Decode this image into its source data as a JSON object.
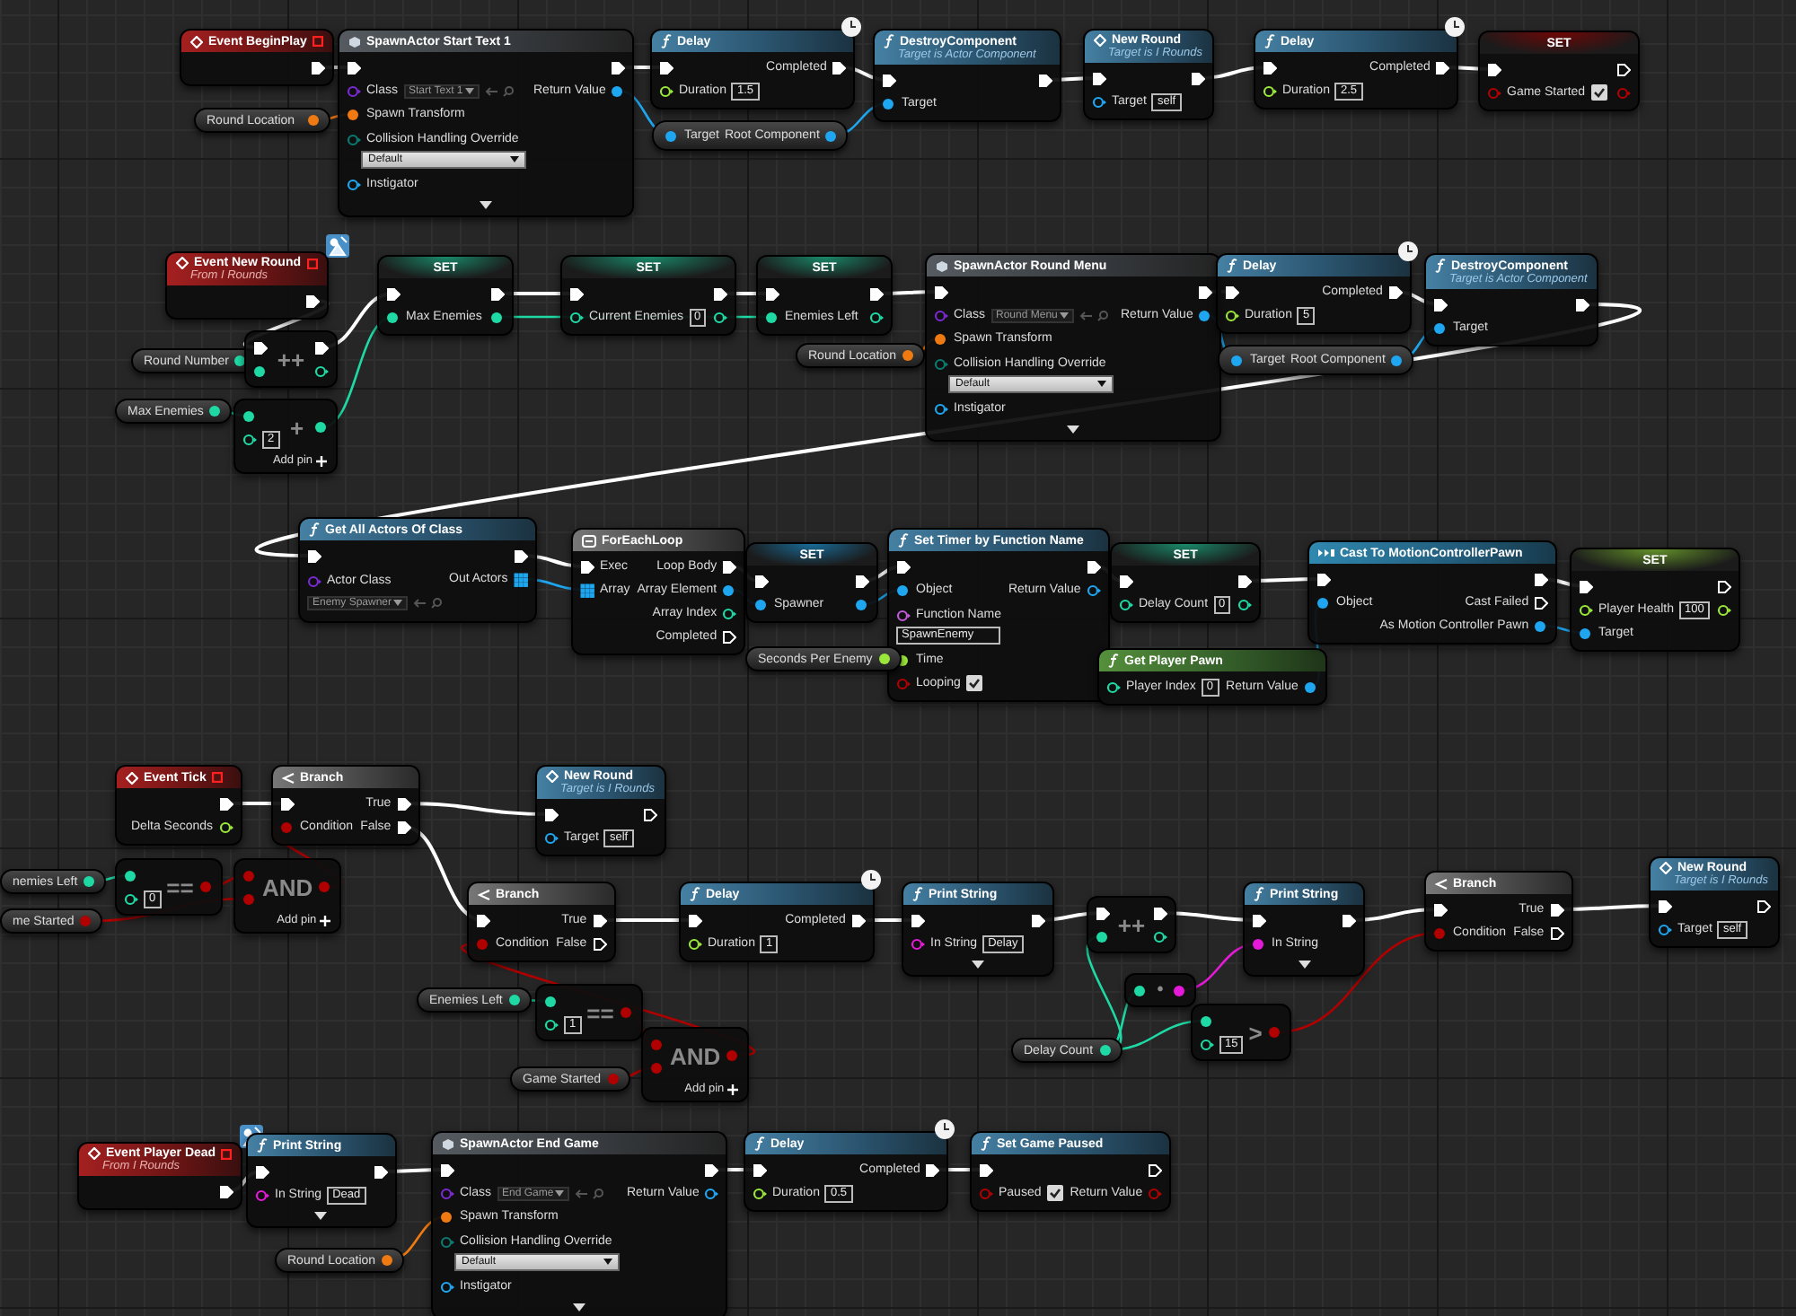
{
  "graph": {
    "nodes": [
      {
        "kind": "event",
        "title": "Event BeginPlay",
        "outputs": [
          {
            "kind": "exec",
            "linked": true
          }
        ]
      },
      {
        "kind": "variable",
        "title": "Round Location",
        "outputs": [
          {
            "kind": "struct",
            "linked": true
          }
        ]
      },
      {
        "kind": "spawn",
        "title": "SpawnActor Start Text 1",
        "advanced": true,
        "inputs": [
          {
            "kind": "exec",
            "linked": true
          },
          {
            "kind": "class",
            "label": "Class",
            "select": "Start Text 1",
            "linked": false
          },
          {
            "kind": "struct",
            "label": "Spawn Transform",
            "linked": true
          },
          {
            "kind": "byte",
            "label": "Collision Handling Override",
            "select": "Default",
            "stacked": true,
            "linked": false
          },
          {
            "kind": "object",
            "label": "Instigator",
            "linked": false
          }
        ],
        "outputs": [
          {
            "kind": "exec",
            "linked": true
          },
          {
            "kind": "object",
            "label": "Return Value",
            "linked": true
          }
        ]
      },
      {
        "kind": "function",
        "title": "Delay",
        "latent": true,
        "inputs": [
          {
            "kind": "exec",
            "linked": true
          },
          {
            "kind": "float",
            "label": "Duration",
            "value": "1.5",
            "linked": false
          }
        ],
        "outputs": [
          {
            "kind": "exec",
            "label": "Completed",
            "linked": true
          }
        ]
      },
      {
        "kind": "getter",
        "inputs": [
          {
            "kind": "object",
            "label": "Target",
            "linked": true
          }
        ],
        "outputs": [
          {
            "kind": "object",
            "label": "Root Component",
            "linked": true
          }
        ]
      },
      {
        "kind": "function",
        "title": "DestroyComponent",
        "subtitle": "Target is Actor Component",
        "inputs": [
          {
            "kind": "exec",
            "linked": true
          },
          {
            "kind": "object",
            "label": "Target",
            "linked": true
          }
        ],
        "outputs": [
          {
            "kind": "exec",
            "linked": true
          }
        ]
      },
      {
        "kind": "message",
        "title": "New Round",
        "subtitle": "Target is I Rounds",
        "inputs": [
          {
            "kind": "exec",
            "linked": true
          },
          {
            "kind": "object",
            "label": "Target",
            "value": "self",
            "linked": false
          }
        ],
        "outputs": [
          {
            "kind": "exec",
            "linked": true
          }
        ]
      },
      {
        "kind": "function",
        "title": "Delay",
        "latent": true,
        "inputs": [
          {
            "kind": "exec",
            "linked": true
          },
          {
            "kind": "float",
            "label": "Duration",
            "value": "2.5",
            "linked": false
          }
        ],
        "outputs": [
          {
            "kind": "exec",
            "label": "Completed",
            "linked": true
          }
        ]
      },
      {
        "kind": "set",
        "title": "SET",
        "inputs": [
          {
            "kind": "exec",
            "linked": true
          },
          {
            "kind": "bool",
            "label": "Game Started",
            "checked": true,
            "linked": false
          }
        ],
        "outputs": [
          {
            "kind": "exec",
            "linked": false
          },
          {
            "kind": "bool",
            "linked": false
          }
        ]
      },
      {
        "kind": "event",
        "title": "Event New Round",
        "subtitle": "From I Rounds",
        "interface": true,
        "outputs": [
          {
            "kind": "exec",
            "linked": true
          }
        ]
      },
      {
        "kind": "variable",
        "title": "Round Number",
        "outputs": [
          {
            "kind": "int",
            "linked": true
          }
        ]
      },
      {
        "kind": "operator",
        "title": "++",
        "inputs": [
          {
            "kind": "exec",
            "linked": true
          },
          {
            "kind": "int",
            "linked": true
          }
        ],
        "outputs": [
          {
            "kind": "exec",
            "linked": true
          },
          {
            "kind": "int",
            "linked": false
          }
        ]
      },
      {
        "kind": "variable",
        "title": "Max Enemies",
        "outputs": [
          {
            "kind": "int",
            "linked": true
          }
        ]
      },
      {
        "kind": "operator",
        "title": "+",
        "add_pin": "Add pin",
        "inputs": [
          {
            "kind": "int",
            "linked": true
          },
          {
            "kind": "int",
            "value": "2",
            "linked": false
          }
        ],
        "outputs": [
          {
            "kind": "int",
            "linked": true
          }
        ]
      },
      {
        "kind": "set",
        "title": "SET",
        "inputs": [
          {
            "kind": "exec",
            "linked": true
          },
          {
            "kind": "int",
            "label": "Max Enemies",
            "linked": true
          }
        ],
        "outputs": [
          {
            "kind": "exec",
            "linked": true
          },
          {
            "kind": "int",
            "linked": true
          }
        ]
      },
      {
        "kind": "set",
        "title": "SET",
        "inputs": [
          {
            "kind": "exec",
            "linked": true
          },
          {
            "kind": "int",
            "label": "Current Enemies",
            "value": "0",
            "linked": false
          }
        ],
        "outputs": [
          {
            "kind": "exec",
            "linked": true
          },
          {
            "kind": "int",
            "linked": false
          }
        ]
      },
      {
        "kind": "set",
        "title": "SET",
        "inputs": [
          {
            "kind": "exec",
            "linked": true
          },
          {
            "kind": "int",
            "label": "Enemies Left",
            "linked": true
          }
        ],
        "outputs": [
          {
            "kind": "exec",
            "linked": true
          },
          {
            "kind": "int",
            "linked": false
          }
        ]
      },
      {
        "kind": "variable",
        "title": "Round Location",
        "outputs": [
          {
            "kind": "struct",
            "linked": true
          }
        ]
      },
      {
        "kind": "spawn",
        "title": "SpawnActor Round Menu",
        "advanced": true,
        "inputs": [
          {
            "kind": "exec",
            "linked": true
          },
          {
            "kind": "class",
            "label": "Class",
            "select": "Round Menu",
            "linked": false
          },
          {
            "kind": "struct",
            "label": "Spawn Transform",
            "linked": true
          },
          {
            "kind": "byte",
            "label": "Collision Handling Override",
            "select": "Default",
            "stacked": true,
            "linked": false
          },
          {
            "kind": "object",
            "label": "Instigator",
            "linked": false
          }
        ],
        "outputs": [
          {
            "kind": "exec",
            "linked": true
          },
          {
            "kind": "object",
            "label": "Return Value",
            "linked": true
          }
        ]
      },
      {
        "kind": "function",
        "title": "Delay",
        "latent": true,
        "inputs": [
          {
            "kind": "exec",
            "linked": true
          },
          {
            "kind": "float",
            "label": "Duration",
            "value": "5",
            "linked": false
          }
        ],
        "outputs": [
          {
            "kind": "exec",
            "label": "Completed",
            "linked": true
          }
        ]
      },
      {
        "kind": "getter",
        "inputs": [
          {
            "kind": "object",
            "label": "Target",
            "linked": true
          }
        ],
        "outputs": [
          {
            "kind": "object",
            "label": "Root Component",
            "linked": true
          }
        ]
      },
      {
        "kind": "function",
        "title": "DestroyComponent",
        "subtitle": "Target is Actor Component",
        "inputs": [
          {
            "kind": "exec",
            "linked": true
          },
          {
            "kind": "object",
            "label": "Target",
            "linked": true
          }
        ],
        "outputs": [
          {
            "kind": "exec",
            "linked": true
          }
        ]
      },
      {
        "kind": "function",
        "title": "Get All Actors Of Class",
        "inputs": [
          {
            "kind": "exec",
            "linked": true
          },
          {
            "kind": "class",
            "label": "Actor Class",
            "select": "Enemy Spawner",
            "stacked": true,
            "linked": false
          }
        ],
        "outputs": [
          {
            "kind": "exec",
            "linked": true
          },
          {
            "kind": "array",
            "label": "Out Actors",
            "linked": true
          }
        ]
      },
      {
        "kind": "macro",
        "title": "ForEachLoop",
        "inputs": [
          {
            "kind": "exec",
            "label": "Exec",
            "linked": true
          },
          {
            "kind": "array",
            "label": "Array",
            "linked": true
          }
        ],
        "outputs": [
          {
            "kind": "exec",
            "label": "Loop Body",
            "linked": true
          },
          {
            "kind": "object",
            "label": "Array Element",
            "linked": true
          },
          {
            "kind": "int",
            "label": "Array Index",
            "linked": false
          },
          {
            "kind": "exec",
            "label": "Completed",
            "linked": false
          }
        ]
      },
      {
        "kind": "set",
        "title": "SET",
        "inputs": [
          {
            "kind": "exec",
            "linked": true
          },
          {
            "kind": "object",
            "label": "Spawner",
            "linked": true
          }
        ],
        "outputs": [
          {
            "kind": "exec",
            "linked": true
          },
          {
            "kind": "object",
            "linked": true
          }
        ]
      },
      {
        "kind": "function",
        "title": "Set Timer by Function Name",
        "inputs": [
          {
            "kind": "exec",
            "linked": true
          },
          {
            "kind": "object",
            "label": "Object",
            "linked": true
          },
          {
            "kind": "name",
            "label": "Function Name",
            "value": "SpawnEnemy",
            "stacked": true,
            "linked": false
          },
          {
            "kind": "float",
            "label": "Time",
            "linked": true
          },
          {
            "kind": "bool",
            "label": "Looping",
            "checked": true,
            "linked": false
          }
        ],
        "outputs": [
          {
            "kind": "exec",
            "linked": true
          },
          {
            "kind": "object",
            "label": "Return Value",
            "linked": false
          }
        ]
      },
      {
        "kind": "variable",
        "title": "Seconds Per Enemy",
        "outputs": [
          {
            "kind": "float",
            "linked": true
          }
        ]
      },
      {
        "kind": "set",
        "title": "SET",
        "inputs": [
          {
            "kind": "exec",
            "linked": true
          },
          {
            "kind": "int",
            "label": "Delay Count",
            "value": "0",
            "linked": false
          }
        ],
        "outputs": [
          {
            "kind": "exec",
            "linked": true
          },
          {
            "kind": "int",
            "linked": false
          }
        ]
      },
      {
        "kind": "pure",
        "title": "Get Player Pawn",
        "inputs": [
          {
            "kind": "int",
            "label": "Player Index",
            "value": "0",
            "linked": false
          }
        ],
        "outputs": [
          {
            "kind": "object",
            "label": "Return Value",
            "linked": true
          }
        ]
      },
      {
        "kind": "cast",
        "title": "Cast To MotionControllerPawn",
        "inputs": [
          {
            "kind": "exec",
            "linked": true
          },
          {
            "kind": "object",
            "label": "Object",
            "linked": true
          }
        ],
        "outputs": [
          {
            "kind": "exec",
            "linked": true
          },
          {
            "kind": "exec",
            "label": "Cast Failed",
            "linked": false
          },
          {
            "kind": "object",
            "label": "As Motion Controller Pawn",
            "linked": true
          }
        ]
      },
      {
        "kind": "set",
        "title": "SET",
        "inputs": [
          {
            "kind": "exec",
            "linked": true
          },
          {
            "kind": "float",
            "label": "Player Health",
            "value": "100",
            "linked": false
          },
          {
            "kind": "object",
            "label": "Target",
            "linked": true
          }
        ],
        "outputs": [
          {
            "kind": "exec",
            "linked": false
          },
          {
            "kind": "float",
            "linked": false
          }
        ]
      },
      {
        "kind": "event",
        "title": "Event Tick",
        "outputs": [
          {
            "kind": "exec",
            "linked": true
          },
          {
            "kind": "float",
            "label": "Delta Seconds",
            "linked": false
          }
        ]
      },
      {
        "kind": "branch",
        "title": "Branch",
        "inputs": [
          {
            "kind": "exec",
            "linked": true
          },
          {
            "kind": "bool",
            "label": "Condition",
            "linked": true
          }
        ],
        "outputs": [
          {
            "kind": "exec",
            "label": "True",
            "linked": true
          },
          {
            "kind": "exec",
            "label": "False",
            "linked": true
          }
        ]
      },
      {
        "kind": "message",
        "title": "New Round",
        "subtitle": "Target is I Rounds",
        "inputs": [
          {
            "kind": "exec",
            "linked": true
          },
          {
            "kind": "object",
            "label": "Target",
            "value": "self",
            "linked": false
          }
        ],
        "outputs": [
          {
            "kind": "exec",
            "linked": false
          }
        ]
      },
      {
        "kind": "variable",
        "title": "nemies Left",
        "outputs": [
          {
            "kind": "int",
            "linked": true
          }
        ]
      },
      {
        "kind": "variable",
        "title": "me Started",
        "outputs": [
          {
            "kind": "bool",
            "linked": true
          }
        ]
      },
      {
        "kind": "operator",
        "title": "==",
        "inputs": [
          {
            "kind": "int",
            "linked": true
          },
          {
            "kind": "int",
            "value": "0",
            "linked": false
          }
        ],
        "outputs": [
          {
            "kind": "bool",
            "linked": true
          }
        ]
      },
      {
        "kind": "operator",
        "title": "AND",
        "add_pin": "Add pin",
        "inputs": [
          {
            "kind": "bool",
            "linked": true
          },
          {
            "kind": "bool",
            "linked": true
          }
        ],
        "outputs": [
          {
            "kind": "bool",
            "linked": true
          }
        ]
      },
      {
        "kind": "branch",
        "title": "Branch",
        "inputs": [
          {
            "kind": "exec",
            "linked": true
          },
          {
            "kind": "bool",
            "label": "Condition",
            "linked": true
          }
        ],
        "outputs": [
          {
            "kind": "exec",
            "label": "True",
            "linked": true
          },
          {
            "kind": "exec",
            "label": "False",
            "linked": false
          }
        ]
      },
      {
        "kind": "variable",
        "title": "Enemies Left",
        "outputs": [
          {
            "kind": "int",
            "linked": true
          }
        ]
      },
      {
        "kind": "operator",
        "title": "==",
        "inputs": [
          {
            "kind": "int",
            "linked": true
          },
          {
            "kind": "int",
            "value": "1",
            "linked": false
          }
        ],
        "outputs": [
          {
            "kind": "bool",
            "linked": true
          }
        ]
      },
      {
        "kind": "operator",
        "title": "AND",
        "add_pin": "Add pin",
        "inputs": [
          {
            "kind": "bool",
            "linked": true
          },
          {
            "kind": "bool",
            "linked": true
          }
        ],
        "outputs": [
          {
            "kind": "bool",
            "linked": true
          }
        ]
      },
      {
        "kind": "variable",
        "title": "Game Started",
        "outputs": [
          {
            "kind": "bool",
            "linked": true
          }
        ]
      },
      {
        "kind": "function",
        "title": "Delay",
        "latent": true,
        "inputs": [
          {
            "kind": "exec",
            "linked": true
          },
          {
            "kind": "float",
            "label": "Duration",
            "value": "1",
            "linked": false
          }
        ],
        "outputs": [
          {
            "kind": "exec",
            "label": "Completed",
            "linked": true
          }
        ]
      },
      {
        "kind": "function",
        "title": "Print String",
        "advanced": true,
        "inputs": [
          {
            "kind": "exec",
            "linked": true
          },
          {
            "kind": "string",
            "label": "In String",
            "value": "Delay",
            "linked": false
          }
        ],
        "outputs": [
          {
            "kind": "exec",
            "linked": true
          }
        ]
      },
      {
        "kind": "operator",
        "title": "++",
        "inputs": [
          {
            "kind": "exec",
            "linked": true
          },
          {
            "kind": "int",
            "linked": true
          }
        ],
        "outputs": [
          {
            "kind": "exec",
            "linked": true
          },
          {
            "kind": "int",
            "linked": false
          }
        ]
      },
      {
        "kind": "function",
        "title": "Print String",
        "advanced": true,
        "inputs": [
          {
            "kind": "exec",
            "linked": true
          },
          {
            "kind": "string",
            "label": "In String",
            "linked": true
          }
        ],
        "outputs": [
          {
            "kind": "exec",
            "linked": true
          }
        ]
      },
      {
        "kind": "operator",
        "title": "•",
        "inputs": [
          {
            "kind": "int",
            "linked": true
          }
        ],
        "outputs": [
          {
            "kind": "string",
            "linked": true
          }
        ]
      },
      {
        "kind": "operator",
        "title": ">",
        "inputs": [
          {
            "kind": "int",
            "linked": true
          },
          {
            "kind": "int",
            "value": "15",
            "linked": false
          }
        ],
        "outputs": [
          {
            "kind": "bool",
            "linked": true
          }
        ]
      },
      {
        "kind": "variable",
        "title": "Delay Count",
        "outputs": [
          {
            "kind": "int",
            "linked": true
          }
        ]
      },
      {
        "kind": "branch",
        "title": "Branch",
        "inputs": [
          {
            "kind": "exec",
            "linked": true
          },
          {
            "kind": "bool",
            "label": "Condition",
            "linked": true
          }
        ],
        "outputs": [
          {
            "kind": "exec",
            "label": "True",
            "linked": true
          },
          {
            "kind": "exec",
            "label": "False",
            "linked": false
          }
        ]
      },
      {
        "kind": "message",
        "title": "New Round",
        "subtitle": "Target is I Rounds",
        "inputs": [
          {
            "kind": "exec",
            "linked": true
          },
          {
            "kind": "object",
            "label": "Target",
            "value": "self",
            "linked": false
          }
        ],
        "outputs": [
          {
            "kind": "exec",
            "linked": false
          }
        ]
      },
      {
        "kind": "event",
        "title": "Event Player Dead",
        "subtitle": "From I Rounds",
        "interface": true,
        "outputs": [
          {
            "kind": "exec",
            "linked": true
          }
        ]
      },
      {
        "kind": "function",
        "title": "Print String",
        "advanced": true,
        "inputs": [
          {
            "kind": "exec",
            "linked": true
          },
          {
            "kind": "string",
            "label": "In String",
            "value": "Dead",
            "linked": false
          }
        ],
        "outputs": [
          {
            "kind": "exec",
            "linked": true
          }
        ]
      },
      {
        "kind": "variable",
        "title": "Round Location",
        "outputs": [
          {
            "kind": "struct",
            "linked": true
          }
        ]
      },
      {
        "kind": "spawn",
        "title": "SpawnActor End Game",
        "advanced": true,
        "inputs": [
          {
            "kind": "exec",
            "linked": true
          },
          {
            "kind": "class",
            "label": "Class",
            "select": "End Game",
            "linked": false
          },
          {
            "kind": "struct",
            "label": "Spawn Transform",
            "linked": true
          },
          {
            "kind": "byte",
            "label": "Collision Handling Override",
            "select": "Default",
            "stacked": true,
            "linked": false
          },
          {
            "kind": "object",
            "label": "Instigator",
            "linked": false
          }
        ],
        "outputs": [
          {
            "kind": "exec",
            "linked": true
          },
          {
            "kind": "object",
            "label": "Return Value",
            "linked": false
          }
        ]
      },
      {
        "kind": "function",
        "title": "Delay",
        "latent": true,
        "inputs": [
          {
            "kind": "exec",
            "linked": true
          },
          {
            "kind": "float",
            "label": "Duration",
            "value": "0.5",
            "linked": false
          }
        ],
        "outputs": [
          {
            "kind": "exec",
            "label": "Completed",
            "linked": true
          }
        ]
      },
      {
        "kind": "function",
        "title": "Set Game Paused",
        "inputs": [
          {
            "kind": "exec",
            "linked": true
          },
          {
            "kind": "bool",
            "label": "Paused",
            "checked": true,
            "linked": false
          }
        ],
        "outputs": [
          {
            "kind": "exec",
            "linked": false
          },
          {
            "kind": "bool",
            "label": "Return Value",
            "linked": false
          }
        ]
      }
    ]
  }
}
